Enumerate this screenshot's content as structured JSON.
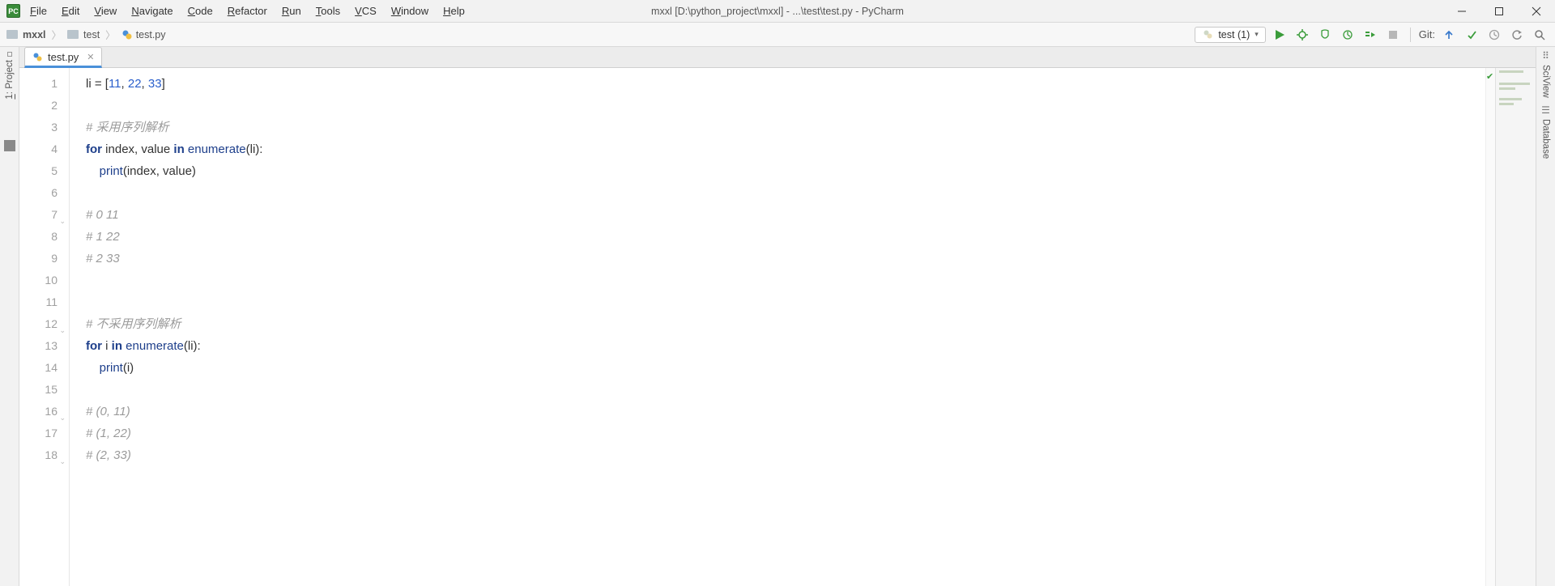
{
  "app_icon_label": "PC",
  "menu": [
    "File",
    "Edit",
    "View",
    "Navigate",
    "Code",
    "Refactor",
    "Run",
    "Tools",
    "VCS",
    "Window",
    "Help"
  ],
  "window_title": "mxxl [D:\\python_project\\mxxl] - ...\\test\\test.py - PyCharm",
  "breadcrumbs": {
    "root": "mxxl",
    "folder": "test",
    "file": "test.py"
  },
  "run_config_label": "test (1)",
  "git_label": "Git:",
  "left_tool_label": "1: Project",
  "right_tool_labels": [
    "SciView",
    "Database"
  ],
  "tab_label": "test.py",
  "line_numbers": [
    "1",
    "2",
    "3",
    "4",
    "5",
    "6",
    "7",
    "8",
    "9",
    "10",
    "11",
    "12",
    "13",
    "14",
    "15",
    "16",
    "17",
    "18"
  ],
  "code_lines": [
    {
      "type": "code",
      "tokens": [
        {
          "t": "li = [",
          "c": ""
        },
        {
          "t": "11",
          "c": "num"
        },
        {
          "t": ", ",
          "c": ""
        },
        {
          "t": "22",
          "c": "num"
        },
        {
          "t": ", ",
          "c": ""
        },
        {
          "t": "33",
          "c": "num"
        },
        {
          "t": "]",
          "c": ""
        }
      ]
    },
    {
      "type": "blank"
    },
    {
      "type": "comment",
      "text": "# 采用序列解析"
    },
    {
      "type": "code",
      "tokens": [
        {
          "t": "for ",
          "c": "kw"
        },
        {
          "t": "index, value ",
          "c": ""
        },
        {
          "t": "in ",
          "c": "kw"
        },
        {
          "t": "enumerate",
          "c": "fn"
        },
        {
          "t": "(li):",
          "c": ""
        }
      ]
    },
    {
      "type": "code",
      "indent": 1,
      "tokens": [
        {
          "t": "print",
          "c": "fn"
        },
        {
          "t": "(index, value)",
          "c": ""
        }
      ]
    },
    {
      "type": "blank"
    },
    {
      "type": "comment",
      "text": "# 0 11",
      "fold": true
    },
    {
      "type": "comment",
      "text": "# 1 22"
    },
    {
      "type": "comment",
      "text": "# 2 33"
    },
    {
      "type": "blank"
    },
    {
      "type": "blank"
    },
    {
      "type": "comment",
      "text": "# 不采用序列解析",
      "fold": true
    },
    {
      "type": "code",
      "tokens": [
        {
          "t": "for ",
          "c": "kw"
        },
        {
          "t": "i ",
          "c": ""
        },
        {
          "t": "in ",
          "c": "kw"
        },
        {
          "t": "enumerate",
          "c": "fn"
        },
        {
          "t": "(li):",
          "c": ""
        }
      ]
    },
    {
      "type": "code",
      "indent": 1,
      "tokens": [
        {
          "t": "print",
          "c": "fn"
        },
        {
          "t": "(i)",
          "c": ""
        }
      ]
    },
    {
      "type": "blank"
    },
    {
      "type": "comment",
      "text": "# (0, 11)",
      "fold": true
    },
    {
      "type": "comment",
      "text": "# (1, 22)"
    },
    {
      "type": "comment",
      "text": "# (2, 33)",
      "fold": true
    }
  ]
}
